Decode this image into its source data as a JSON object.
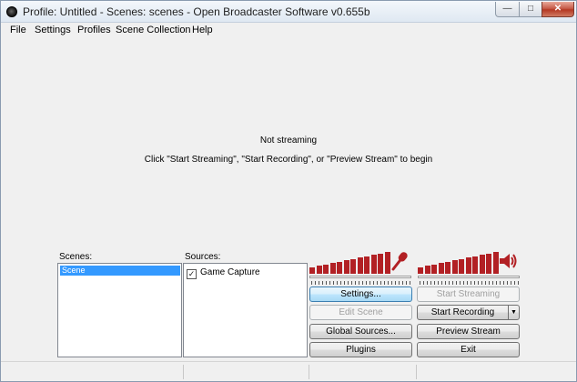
{
  "window": {
    "title": "Profile: Untitled - Scenes: scenes - Open Broadcaster Software v0.655b",
    "controls": {
      "minimize": "—",
      "maximize": "□",
      "close": "✕"
    }
  },
  "menu": [
    {
      "label": "File"
    },
    {
      "label": "Settings"
    },
    {
      "label": "Profiles"
    },
    {
      "label": "Scene Collection"
    },
    {
      "label": "Help"
    }
  ],
  "preview": {
    "status": "Not streaming",
    "hint": "Click \"Start Streaming\", \"Start Recording\", or \"Preview Stream\" to begin"
  },
  "scenes": {
    "label": "Scenes:",
    "items": [
      "Scene"
    ],
    "selected_index": 0
  },
  "sources": {
    "label": "Sources:",
    "items": [
      {
        "label": "Game Capture",
        "checked": true
      }
    ],
    "check_glyph": "✓"
  },
  "audio": {
    "mic_icon": "microphone-icon",
    "speaker_icon": "speaker-icon",
    "meter_color": "#b22024"
  },
  "buttons": {
    "settings": "Settings...",
    "start_streaming": "Start Streaming",
    "edit_scene": "Edit Scene",
    "start_recording": "Start Recording",
    "global_sources": "Global Sources...",
    "preview_stream": "Preview Stream",
    "plugins": "Plugins",
    "exit": "Exit",
    "recording_dropdown": "▼"
  }
}
